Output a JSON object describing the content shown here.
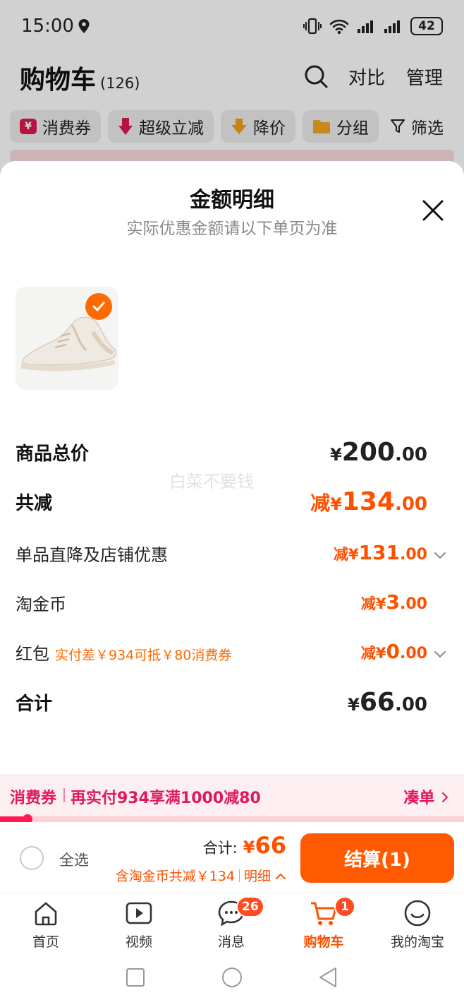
{
  "status_bar": {
    "time": "15:00",
    "battery": "42"
  },
  "cart_header": {
    "title": "购物车",
    "count": "(126)",
    "compare_label": "对比",
    "manage_label": "管理"
  },
  "filters": [
    {
      "label": "消费券",
      "icon": "coupon-icon"
    },
    {
      "label": "超级立减",
      "icon": "down-arrow-icon"
    },
    {
      "label": "降价",
      "icon": "price-drop-icon"
    },
    {
      "label": "分组",
      "icon": "folder-icon"
    },
    {
      "label": "筛选",
      "icon": "filter-icon"
    }
  ],
  "sheet": {
    "title": "金额明细",
    "subtitle": "实际优惠金额请以下单页为准",
    "watermark": "白菜不要钱",
    "rows": {
      "goods_total": {
        "label": "商品总价",
        "cur": "¥",
        "int": "200",
        "dec": ".00"
      },
      "total_reduce": {
        "label": "共减",
        "prefix": "减",
        "cur": "¥",
        "int": "134",
        "dec": ".00"
      },
      "direct_discount": {
        "label": "单品直降及店铺优惠",
        "prefix": "减",
        "cur": "¥",
        "int": "131",
        "dec": ".00"
      },
      "tao_coins": {
        "label": "淘金币",
        "prefix": "减",
        "cur": "¥",
        "int": "3",
        "dec": ".00"
      },
      "red_packet": {
        "label": "红包",
        "hint": "实付差￥934可抵￥80消费券",
        "prefix": "减",
        "cur": "¥",
        "int": "0",
        "dec": ".00"
      },
      "sum": {
        "label": "合计",
        "cur": "¥",
        "int": "66",
        "dec": ".00"
      }
    }
  },
  "coupon_banner": {
    "tag": "消费券",
    "text": "再实付934享满1000减80",
    "link": "凑单",
    "progress": 0.06
  },
  "checkout": {
    "select_all": "全选",
    "total_label": "合计:",
    "total_cur": "¥",
    "total_value": "66",
    "discount_text": "含淘金币共减￥134",
    "detail_label": "明细",
    "button": "结算(1)"
  },
  "tabbar": [
    {
      "label": "首页",
      "icon": "home-icon"
    },
    {
      "label": "视频",
      "icon": "video-icon"
    },
    {
      "label": "消息",
      "icon": "message-icon",
      "badge": "26"
    },
    {
      "label": "购物车",
      "icon": "cart-icon",
      "badge": "1",
      "active": true
    },
    {
      "label": "我的淘宝",
      "icon": "profile-icon"
    }
  ],
  "colors": {
    "accent": "#ff5000",
    "coupon": "#e0185c",
    "button": "#ff5a00"
  }
}
